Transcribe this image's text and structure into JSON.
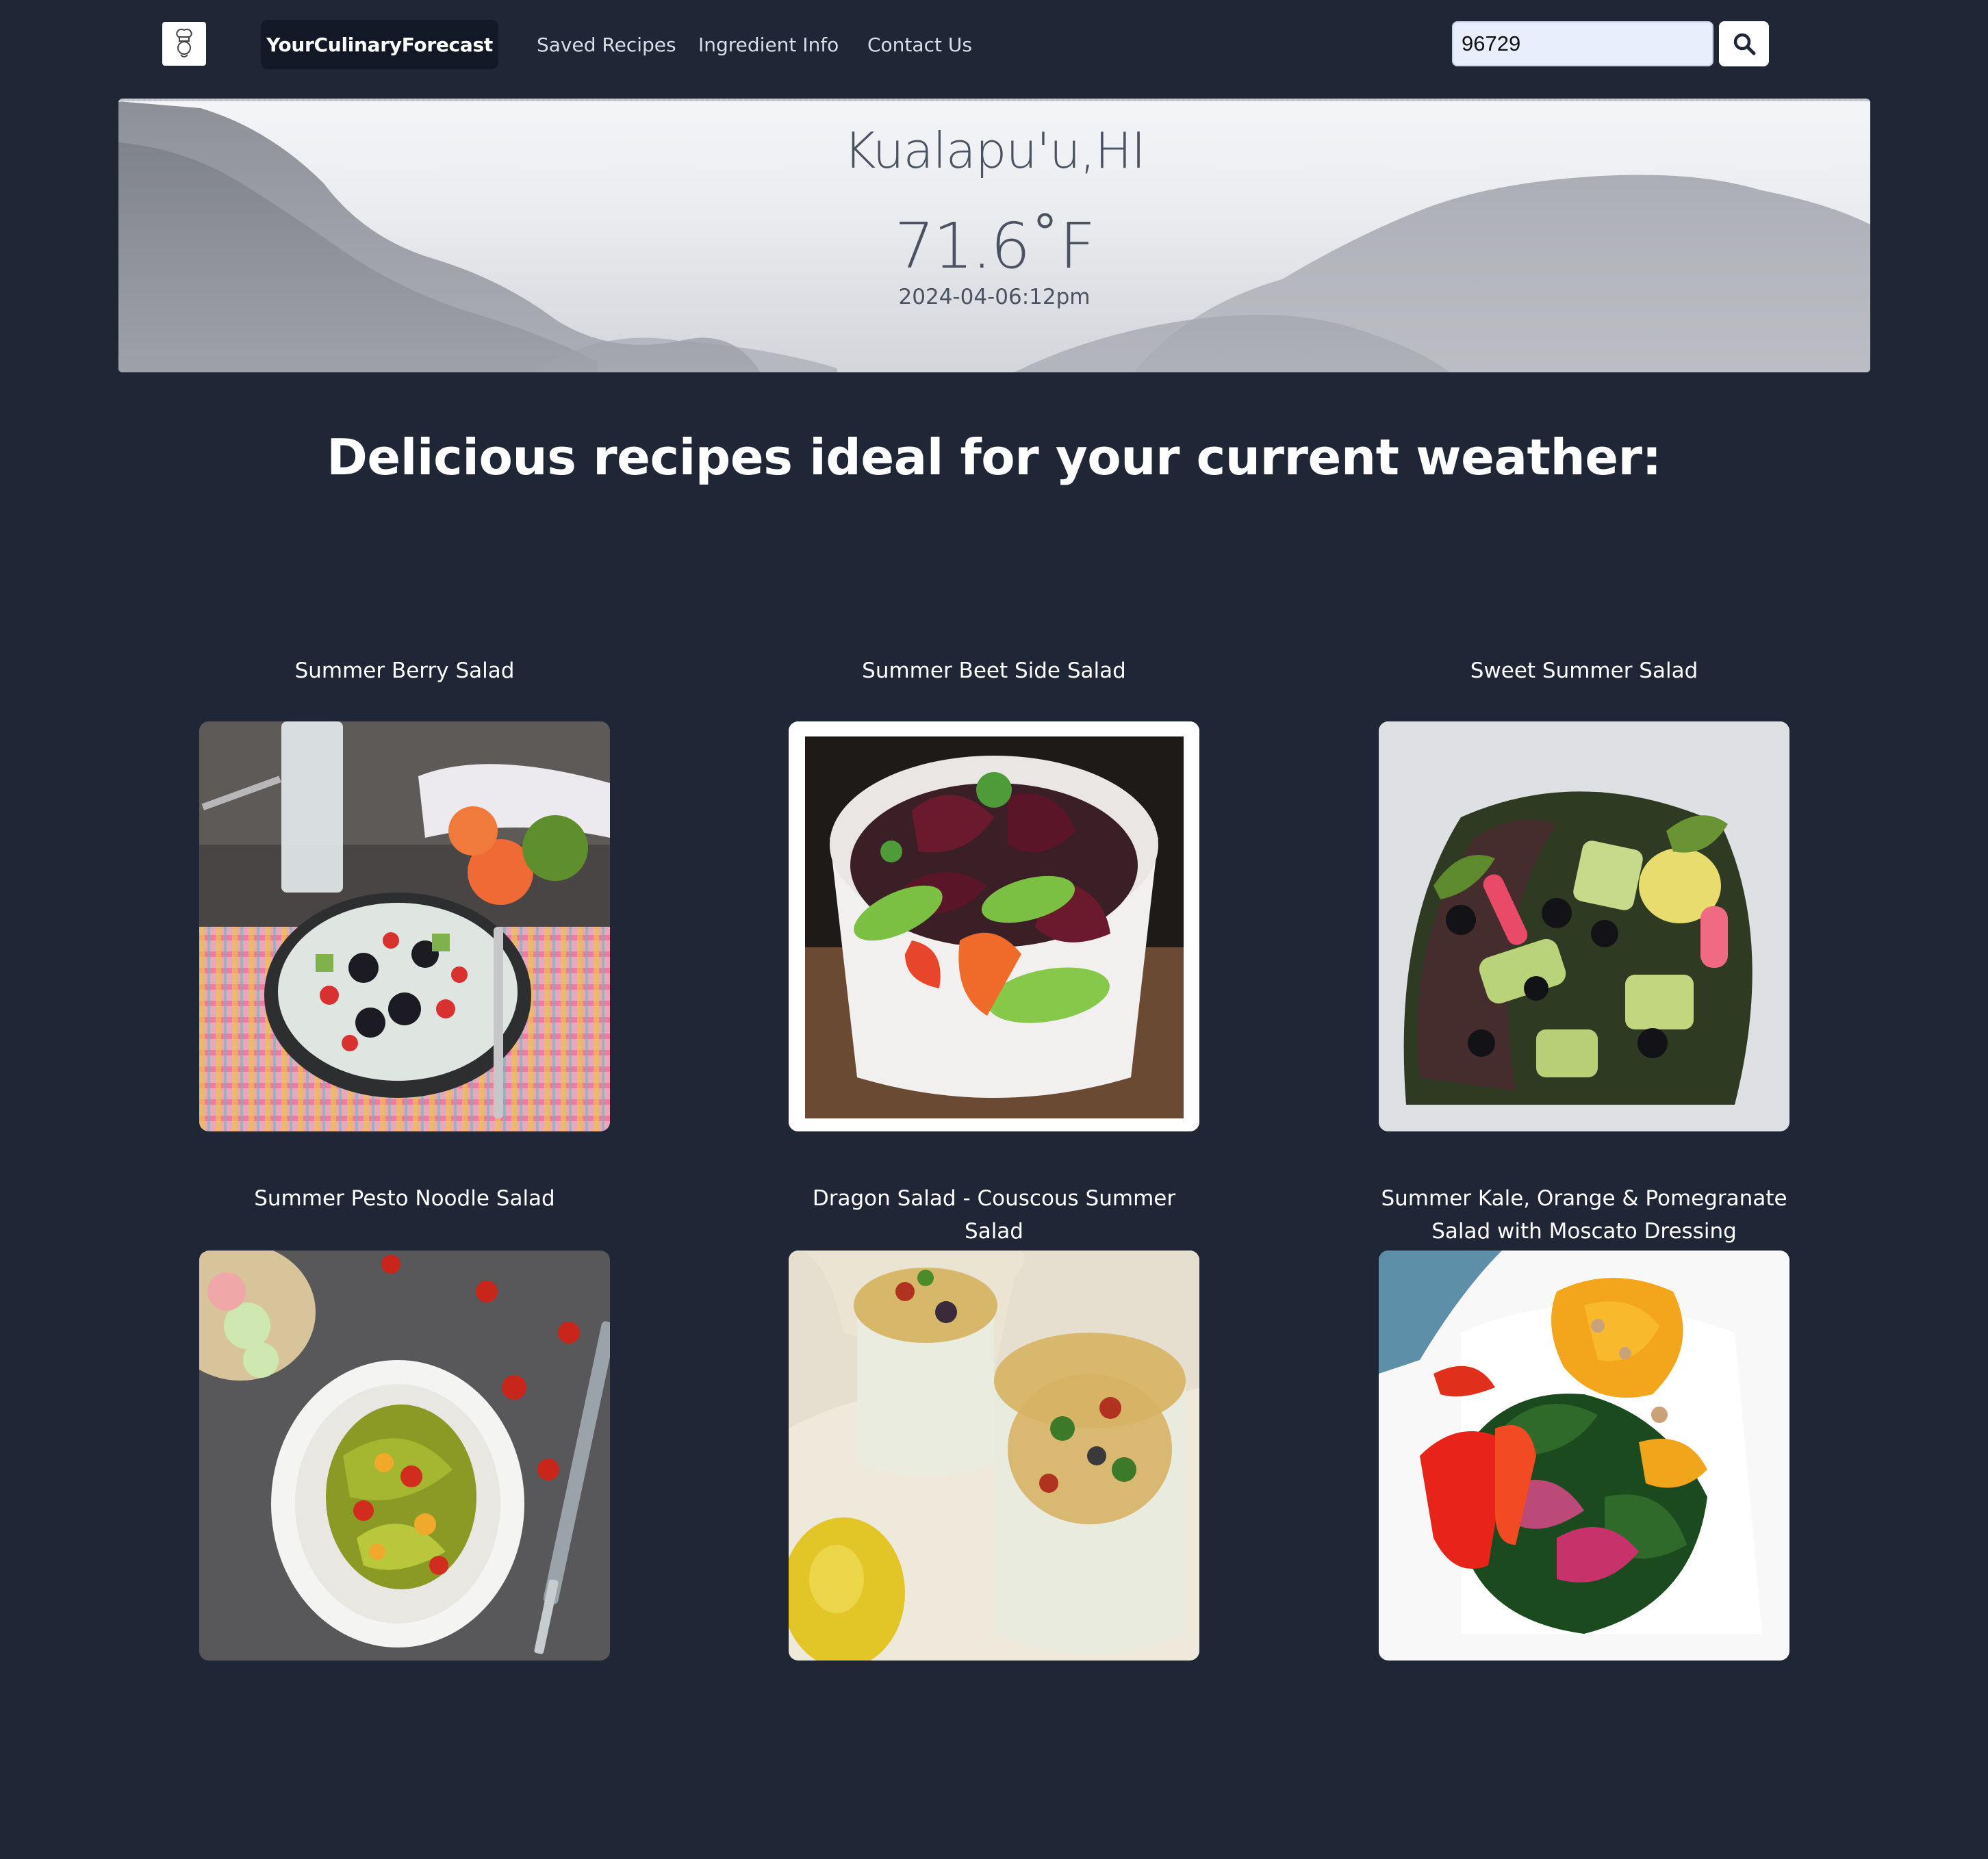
{
  "navbar": {
    "logo_icon": "chef-hat-logo",
    "brand": "YourCulinaryForecast",
    "links": [
      "Saved Recipes",
      "Ingredient Info",
      "Contact Us"
    ],
    "search": {
      "value": "96729",
      "icon": "search-icon"
    }
  },
  "weather": {
    "location": "Kualapu'u,HI",
    "temperature": "71.6˚F",
    "datetime": "2024-04-06:12pm"
  },
  "heading": "Delicious recipes ideal for your current weather:",
  "recipes": [
    {
      "title": "Summer Berry Salad"
    },
    {
      "title": "Summer Beet Side Salad"
    },
    {
      "title": "Sweet Summer Salad"
    },
    {
      "title": "Summer Pesto Noodle Salad"
    },
    {
      "title": "Dragon Salad - Couscous Summer Salad"
    },
    {
      "title": "Summer Kale, Orange & Pomegranate Salad with Moscato Dressing"
    }
  ]
}
